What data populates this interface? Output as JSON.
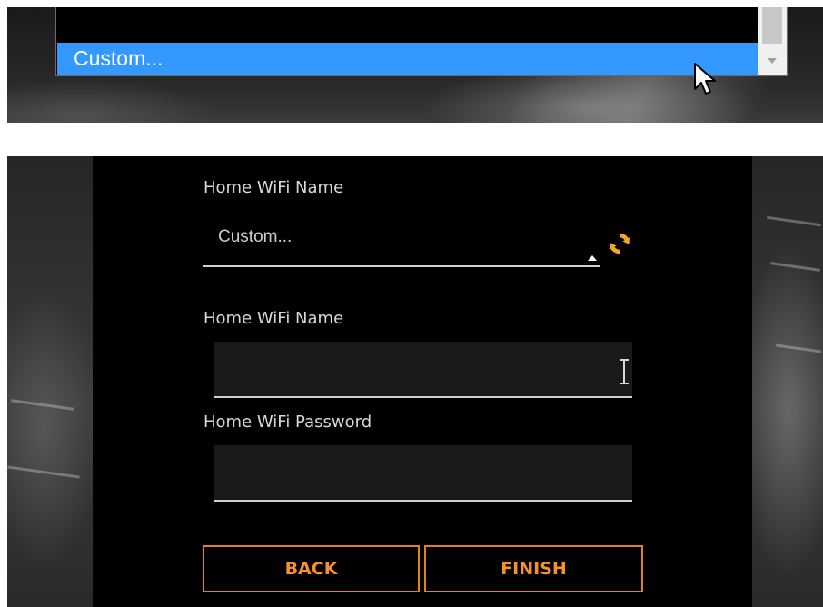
{
  "dropdown_list": {
    "highlighted_option": "Custom..."
  },
  "form": {
    "select_label": "Home WiFi Name",
    "select_value": "Custom...",
    "name_label": "Home WiFi Name",
    "name_value": "",
    "password_label": "Home WiFi Password",
    "password_value": "",
    "back_label": "BACK",
    "finish_label": "FINISH"
  },
  "icons": {
    "refresh": "refresh-icon",
    "caret": "caret-up-icon",
    "scroll_down": "scroll-down-arrow-icon",
    "pointer": "mouse-pointer-icon",
    "text_cursor": "text-cursor-icon"
  },
  "colors": {
    "accent": "#f5912a",
    "highlight": "#3399ff",
    "card_background": "#000000",
    "input_background": "#1a1a1a"
  }
}
